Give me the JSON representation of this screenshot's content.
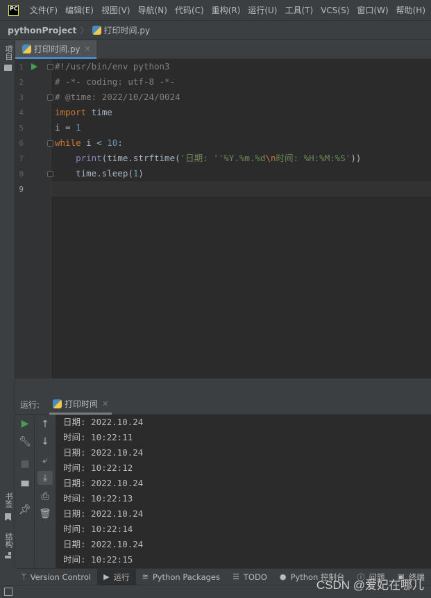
{
  "menubar": {
    "logo": "PC",
    "items": [
      "文件(F)",
      "编辑(E)",
      "视图(V)",
      "导航(N)",
      "代码(C)",
      "重构(R)",
      "运行(U)",
      "工具(T)",
      "VCS(S)",
      "窗口(W)",
      "帮助(H)"
    ]
  },
  "breadcrumb": {
    "project": "pythonProject",
    "file": "打印时间.py"
  },
  "left_strip": {
    "project": "项目",
    "bookmarks": "书签",
    "structure": "结构"
  },
  "editor": {
    "tab": "打印时间.py",
    "line_numbers": [
      "1",
      "2",
      "3",
      "4",
      "5",
      "6",
      "7",
      "8",
      "9"
    ],
    "lines": [
      [
        {
          "t": "#!/usr/bin/env python3",
          "c": "comment"
        }
      ],
      [
        {
          "t": "# -*- coding: utf-8 -*-",
          "c": "comment"
        }
      ],
      [
        {
          "t": "# @time: 2022/10/24/0024",
          "c": "comment"
        }
      ],
      [
        {
          "t": "import",
          "c": "kw"
        },
        {
          "t": " time",
          "c": "plain"
        }
      ],
      [
        {
          "t": "i = ",
          "c": "plain"
        },
        {
          "t": "1",
          "c": "num"
        }
      ],
      [
        {
          "t": "while",
          "c": "kw"
        },
        {
          "t": " i < ",
          "c": "plain"
        },
        {
          "t": "10",
          "c": "num"
        },
        {
          "t": ":",
          "c": "plain"
        }
      ],
      [
        {
          "t": "    ",
          "c": "plain"
        },
        {
          "t": "print",
          "c": "builtin"
        },
        {
          "t": "(time.strftime(",
          "c": "plain"
        },
        {
          "t": "'日期: ''%Y.%m.%d",
          "c": "str"
        },
        {
          "t": "\\n",
          "c": "esc"
        },
        {
          "t": "时间: %H:%M:%S'",
          "c": "str"
        },
        {
          "t": "))",
          "c": "plain"
        }
      ],
      [
        {
          "t": "    time.sleep(",
          "c": "plain"
        },
        {
          "t": "1",
          "c": "num"
        },
        {
          "t": ")",
          "c": "plain"
        }
      ],
      []
    ]
  },
  "run": {
    "label": "运行:",
    "tab": "打印时间",
    "output": [
      "日期: 2022.10.24",
      "时间: 10:22:11",
      "日期: 2022.10.24",
      "时间: 10:22:12",
      "日期: 2022.10.24",
      "时间: 10:22:13",
      "日期: 2022.10.24",
      "时间: 10:22:14",
      "日期: 2022.10.24",
      "时间: 10:22:15"
    ]
  },
  "toolwindows": [
    {
      "label": "Version Control",
      "icon": "branch-icon"
    },
    {
      "label": "运行",
      "icon": "run-icon",
      "active": true
    },
    {
      "label": "Python Packages",
      "icon": "layers-icon"
    },
    {
      "label": "TODO",
      "icon": "list-icon"
    },
    {
      "label": "Python 控制台",
      "icon": "python-icon"
    },
    {
      "label": "问题",
      "icon": "info-icon"
    },
    {
      "label": "终端",
      "icon": "terminal-icon"
    }
  ],
  "watermark": "CSDN @爱妃在哪儿",
  "colors": {
    "keyword": "#cc7832",
    "number": "#6897bb",
    "string": "#6a8759",
    "comment": "#808080",
    "run": "#499c54"
  }
}
